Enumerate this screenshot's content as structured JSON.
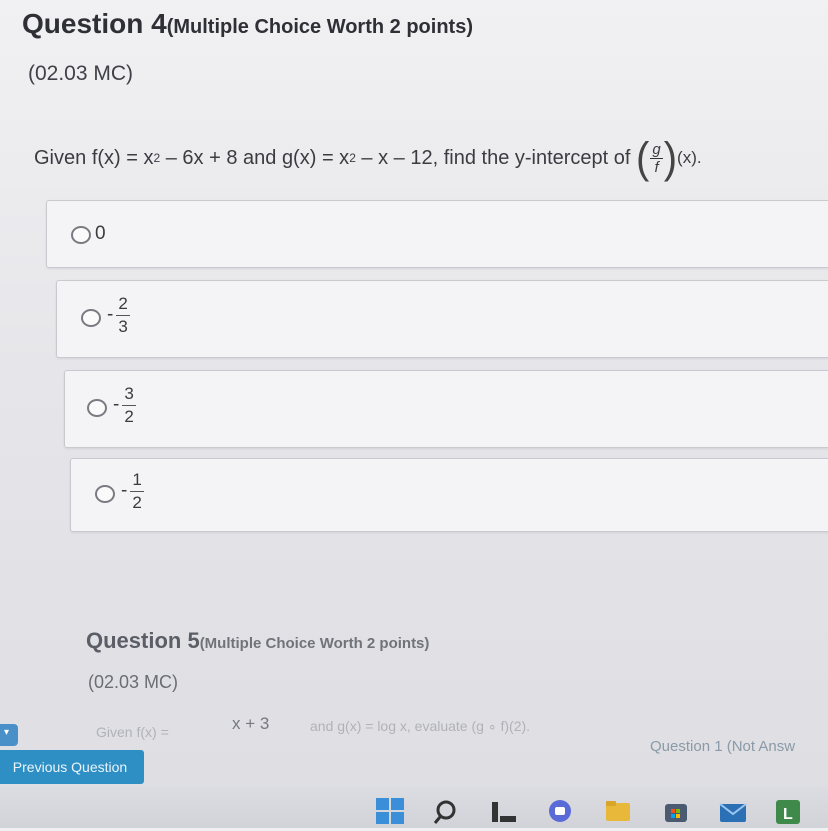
{
  "question4": {
    "title": "Question 4",
    "worth": "(Multiple Choice Worth 2 points)",
    "code": "(02.03 MC)",
    "stem": {
      "given": "Given ",
      "f_def": "f(x) = x",
      "f_exp": "2",
      "f_rest": " – 6x + 8 and ",
      "g_def": "g(x) = x",
      "g_exp": "2",
      "g_rest": " – x – 12, find the y-intercept of ",
      "frac_num": "g",
      "frac_den": "f",
      "suffix": "(x)."
    },
    "options": [
      {
        "sign": "",
        "plain": "0"
      },
      {
        "sign": "-",
        "num": "2",
        "den": "3"
      },
      {
        "sign": "-",
        "num": "3",
        "den": "2"
      },
      {
        "sign": "-",
        "num": "1",
        "den": "2"
      }
    ]
  },
  "question5": {
    "title": "Question 5",
    "worth": "(Multiple Choice Worth 2 points)",
    "code": "(02.03 MC)",
    "stem_start": "Given f(x) =",
    "stem_num": "x + 3",
    "stem_rest": "and g(x) = log x, evaluate (g ∘ f)(2)."
  },
  "nav": {
    "previous_label": "Previous Question",
    "status": "Question 1 (Not Answ"
  },
  "taskbar": {
    "icons": [
      "windows-icon",
      "search-icon",
      "task-view-icon",
      "chat-icon",
      "file-explorer-icon",
      "store-icon",
      "mail-icon",
      "app-l-icon"
    ]
  },
  "colors": {
    "prev_button": "#2e8fc4",
    "background": "#e6e6ea"
  }
}
